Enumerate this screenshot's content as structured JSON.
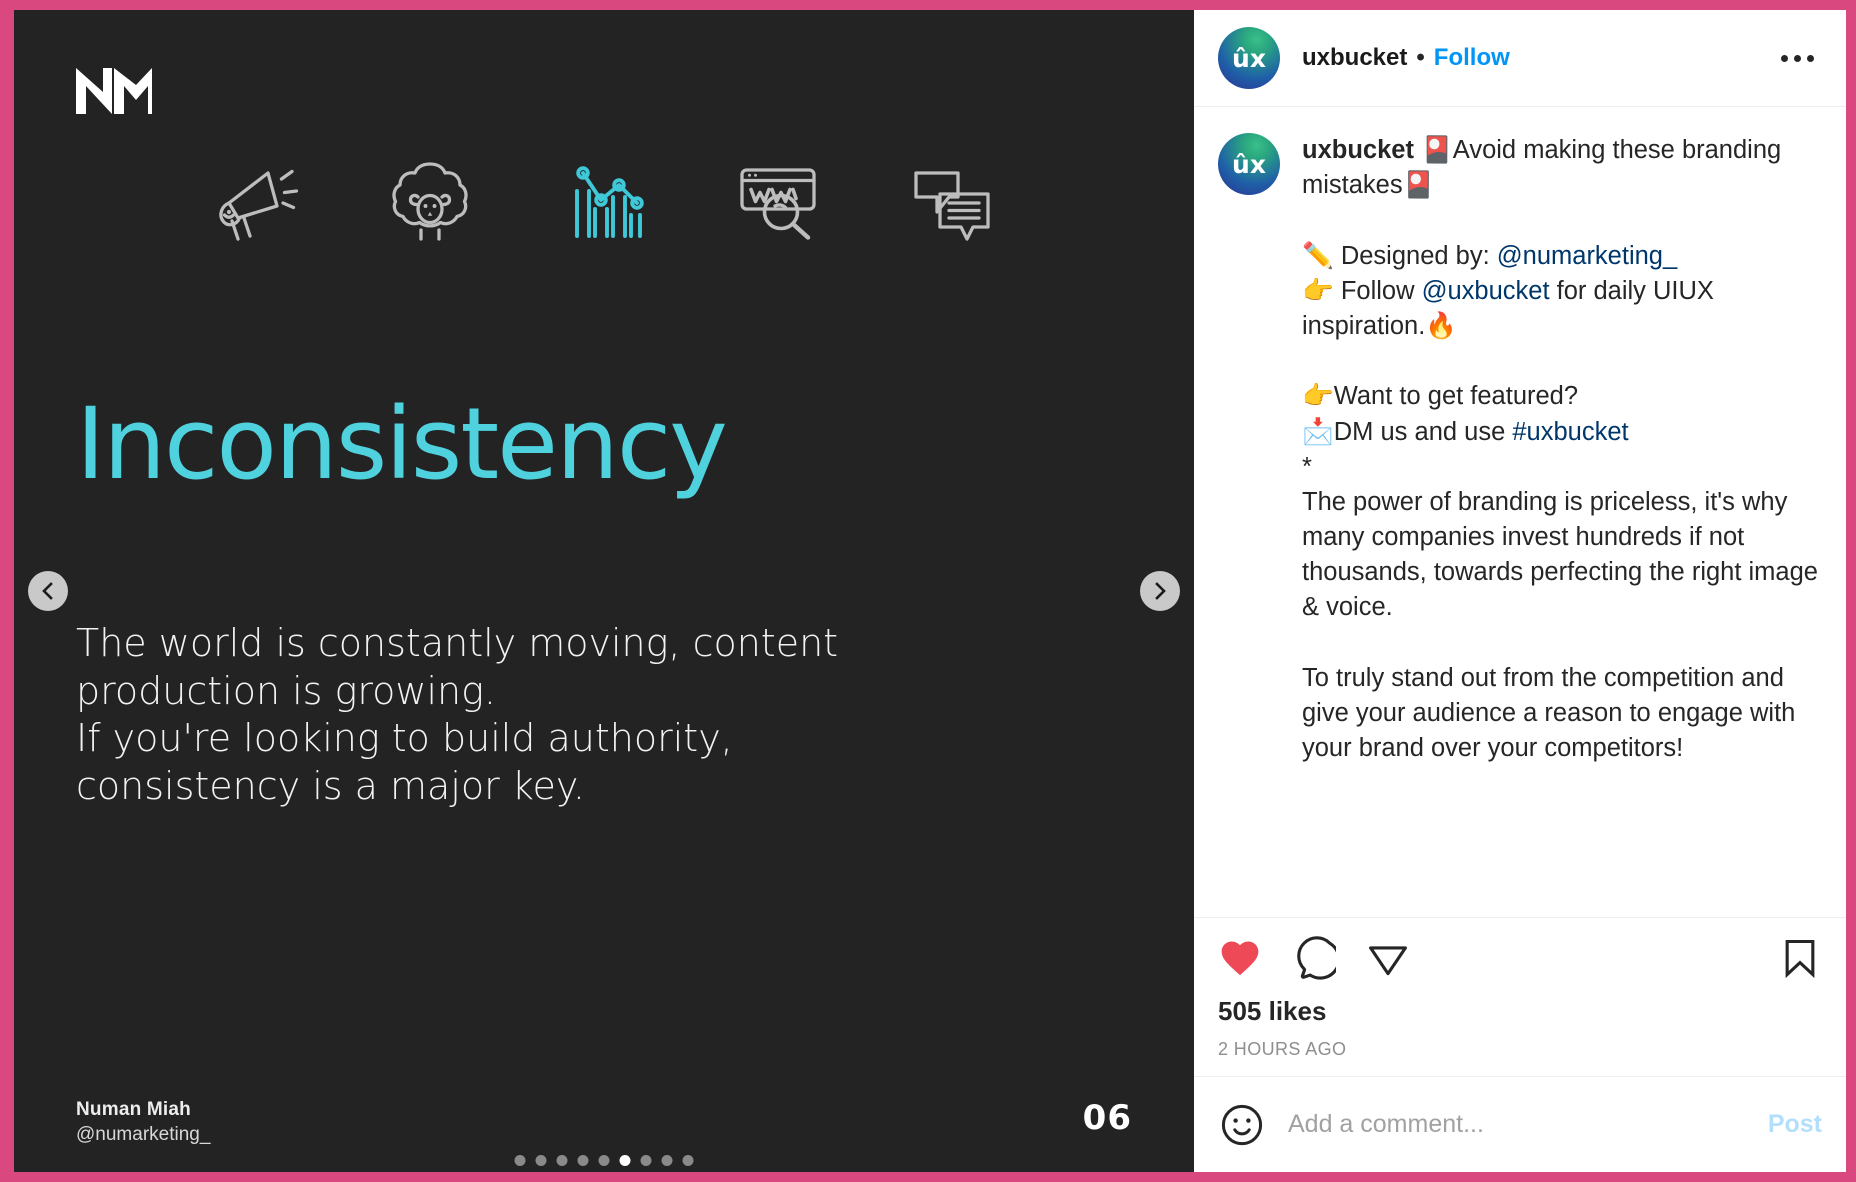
{
  "theme": {
    "frame_pink": "#D9497F",
    "slide_bg": "#232323",
    "accent_cyan": "#4FD2DE",
    "link_blue": "#0095F6",
    "mention_blue": "#00376B",
    "heart_red": "#ED4956"
  },
  "slide": {
    "brand_logo": "nm-monogram-logo",
    "icons": [
      {
        "name": "megaphone-icon",
        "active": false
      },
      {
        "name": "sheep-icon",
        "active": false
      },
      {
        "name": "analytics-chart-icon",
        "active": true
      },
      {
        "name": "www-search-icon",
        "active": false
      },
      {
        "name": "chat-bubbles-icon",
        "active": false
      }
    ],
    "title": "Inconsistency",
    "body": "The world is constantly moving, content production is growing.\nIf you're looking to build authority, consistency is a major key.",
    "author_name": "Numan Miah",
    "author_handle": "@numarketing_",
    "slide_number": "06",
    "prev_label": "Previous",
    "next_label": "Next",
    "dots_total": 9,
    "dots_active_index": 5
  },
  "header": {
    "avatar_text": "ûx",
    "username": "uxbucket",
    "separator": "•",
    "follow_label": "Follow",
    "more_label": "More options"
  },
  "caption": {
    "avatar_text": "ûx",
    "username": "uxbucket",
    "line1_rest": " 🎴Avoid making these branding mistakes🎴",
    "blocks": [
      {
        "text": "✏️ Designed by: ",
        "type": "plain"
      },
      {
        "text": "@numarketing_",
        "type": "link"
      },
      {
        "text": "\n👉 Follow ",
        "type": "plain"
      },
      {
        "text": "@uxbucket",
        "type": "link"
      },
      {
        "text": " for daily UIUX inspiration.🔥\n\n👉Want to get featured?\n📩DM us and use ",
        "type": "plain"
      },
      {
        "text": "#uxbucket",
        "type": "link"
      },
      {
        "text": "\n*\nThe power of branding is priceless, it's why many companies invest hundreds if not thousands, towards perfecting the right image & voice.\n\nTo truly stand out from the competition and give your audience a reason to engage with your brand over your competitors!",
        "type": "plain"
      }
    ]
  },
  "actions": {
    "like_label": "Unlike",
    "like_active": true,
    "comment_label": "Comment",
    "share_label": "Share Post",
    "save_label": "Save",
    "likes_count": "505 likes",
    "timestamp": "2 HOURS AGO"
  },
  "comment_box": {
    "emoji_label": "Emoji picker",
    "placeholder": "Add a comment...",
    "value": "",
    "post_label": "Post"
  }
}
